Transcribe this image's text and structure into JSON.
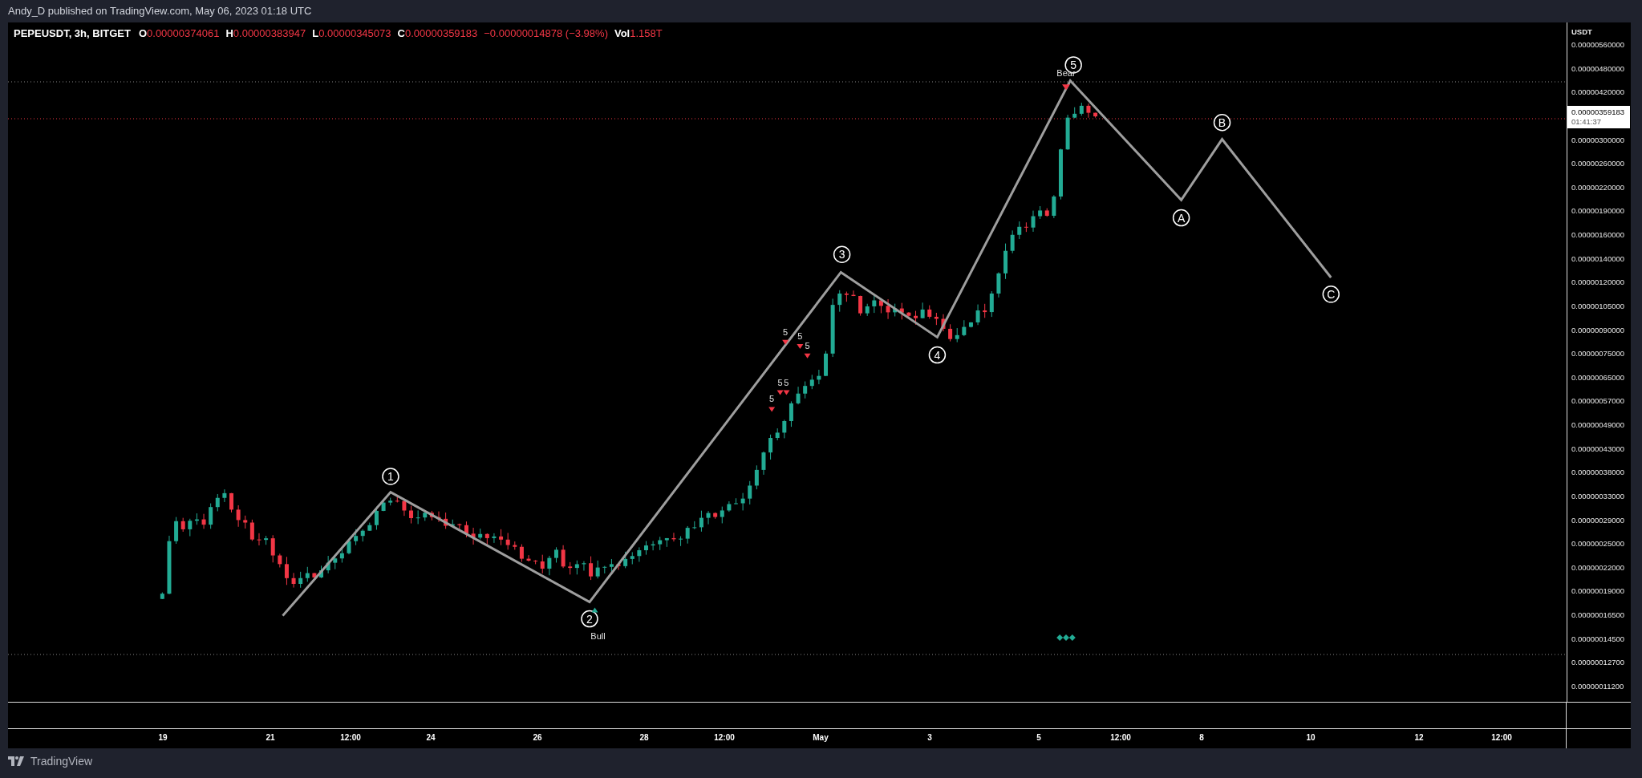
{
  "attribution": "Andy_D published on TradingView.com, May 06, 2023 01:18 UTC",
  "legend": {
    "symbol": "PEPEUSDT, 3h, BITGET",
    "ohlc": [
      {
        "key": "O",
        "value": "0.00000374061"
      },
      {
        "key": "H",
        "value": "0.00000383947"
      },
      {
        "key": "L",
        "value": "0.00000345073"
      },
      {
        "key": "C",
        "value": "0.00000359183"
      }
    ],
    "change": "−0.00000014878 (−3.98%)",
    "volume": {
      "key": "Vol",
      "value": "1.158T"
    }
  },
  "wave_labels": [
    "1",
    "2",
    "3",
    "4",
    "5",
    "A",
    "B",
    "C"
  ],
  "count_marks": [
    "5",
    "5",
    "5",
    "5",
    "5",
    "5"
  ],
  "signals": [
    {
      "kind": "bear",
      "text": "Bear"
    },
    {
      "kind": "bull",
      "text": "Bull"
    }
  ],
  "price_axis": {
    "unit": "USDT",
    "labels": [
      "0.00000560000",
      "0.00000480000",
      "0.00000420000",
      "0.00000300000",
      "0.00000260000",
      "0.00000220000",
      "0.00000190000",
      "0.00000160000",
      "0.00000140000",
      "0.00000120000",
      "0.00000105000",
      "0.00000090000",
      "0.00000075000",
      "0.00000065000",
      "0.00000057000",
      "0.00000049000",
      "0.00000043000",
      "0.00000038000",
      "0.00000033000",
      "0.00000029000",
      "0.00000025000",
      "0.00000022000",
      "0.00000019000",
      "0.00000016500",
      "0.00000014500",
      "0.00000012700",
      "0.00000011200"
    ],
    "current_price": "0.00000359183",
    "countdown": "01:41:37"
  },
  "time_axis": {
    "labels": [
      "19",
      "21",
      "12:00",
      "24",
      "26",
      "28",
      "12:00",
      "May",
      "3",
      "5",
      "12:00",
      "8",
      "10",
      "12",
      "12:00"
    ]
  },
  "footer": {
    "brand": "TradingView"
  }
}
